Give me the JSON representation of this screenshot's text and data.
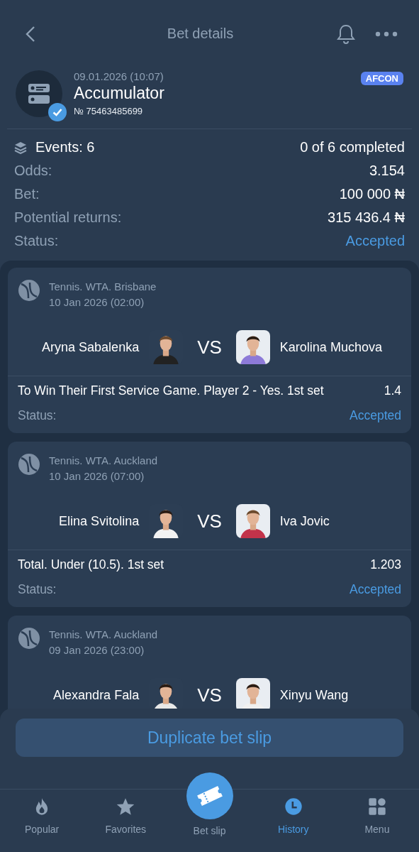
{
  "header": {
    "title": "Bet details"
  },
  "bet": {
    "date": "09.01.2026 (10:07)",
    "type": "Accumulator",
    "number": "№ 75463485699",
    "badge": "AFCON"
  },
  "summary": {
    "events": "Events: 6",
    "completed": "0 of 6 completed",
    "rows": [
      {
        "label": "Odds:",
        "value": "3.154",
        "kind": "plain"
      },
      {
        "label": "Bet:",
        "value": "100 000 ₦",
        "kind": "plain"
      },
      {
        "label": "Potential returns:",
        "value": "315 436.4 ₦",
        "kind": "plain"
      },
      {
        "label": "Status:",
        "value": "Accepted",
        "kind": "status"
      }
    ]
  },
  "events": [
    {
      "league": "Tennis. WTA. Brisbane",
      "date": "10 Jan 2026 (02:00)",
      "player1": "Aryna Sabalenka",
      "vs": "VS",
      "player2": "Karolina Muchova",
      "market": "To Win Their First Service Game. Player 2 - Yes. 1st set",
      "odds": "1.4",
      "status_label": "Status:",
      "status": "Accepted"
    },
    {
      "league": "Tennis. WTA. Auckland",
      "date": "10 Jan 2026 (07:00)",
      "player1": "Elina Svitolina",
      "vs": "VS",
      "player2": "Iva Jovic",
      "market": "Total. Under (10.5). 1st set",
      "odds": "1.203",
      "status_label": "Status:",
      "status": "Accepted"
    },
    {
      "league": "Tennis. WTA. Auckland",
      "date": "09 Jan 2026 (23:00)",
      "player1": "Alexandra Fala",
      "vs": "VS",
      "player2": "Xinyu Wang"
    }
  ],
  "footer": {
    "button": "Duplicate bet slip",
    "nav": [
      {
        "label": "Popular",
        "kind": "popular",
        "selected": false
      },
      {
        "label": "Favorites",
        "kind": "favorites",
        "selected": false
      },
      {
        "label": "Bet slip",
        "kind": "betslip",
        "selected": false
      },
      {
        "label": "History",
        "kind": "history",
        "selected": true
      },
      {
        "label": "Menu",
        "kind": "menu",
        "selected": false
      }
    ]
  }
}
